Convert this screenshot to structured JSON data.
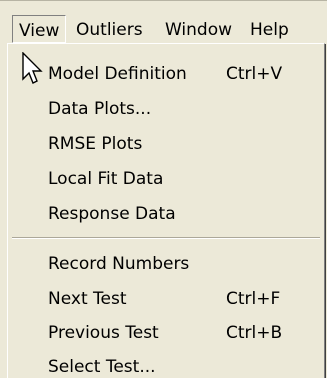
{
  "menubar": {
    "items": [
      {
        "label": "View"
      },
      {
        "label": "Outliers"
      },
      {
        "label": "Window"
      },
      {
        "label": "Help"
      }
    ]
  },
  "menu": {
    "group1": [
      {
        "label": "Model Definition",
        "shortcut": "Ctrl+V"
      },
      {
        "label": "Data Plots..."
      },
      {
        "label": "RMSE Plots"
      },
      {
        "label": "Local Fit Data"
      },
      {
        "label": "Response Data"
      }
    ],
    "group2": [
      {
        "label": "Record Numbers"
      },
      {
        "label": "Next Test",
        "shortcut": "Ctrl+F"
      },
      {
        "label": "Previous Test",
        "shortcut": "Ctrl+B"
      },
      {
        "label": "Select Test..."
      }
    ]
  },
  "icons": {
    "cursor": "mouse-pointer-icon"
  },
  "colors": {
    "background": "#ece9d8",
    "shadow": "#808080",
    "highlight": "#ffffff",
    "text": "#000000"
  }
}
